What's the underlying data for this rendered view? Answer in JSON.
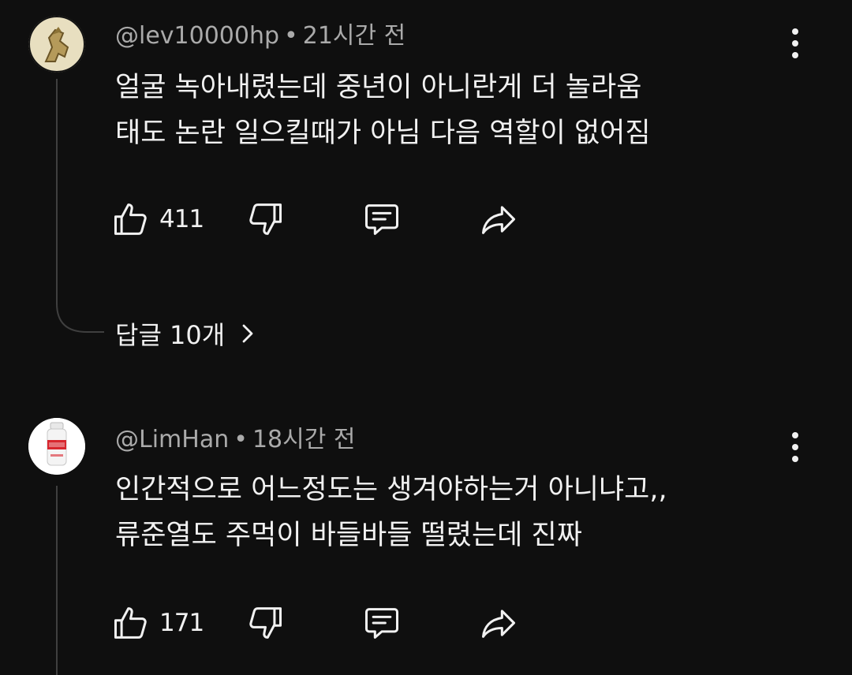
{
  "comments": [
    {
      "author": "@lev10000hp",
      "separator": "•",
      "time": "21시간 전",
      "lines": [
        "얼굴 녹아내렸는데 중년이 아니란게 더 놀라움",
        "태도 논란 일으킬때가 아님 다음 역할이 없어짐"
      ],
      "likes": "411",
      "icons": {
        "avatar": "avatar-image",
        "like": "thumbs-up-icon",
        "dislike": "thumbs-down-icon",
        "reply": "comment-icon",
        "share": "share-icon",
        "menu": "more-vert-icon"
      },
      "replies_label": "답글 10개",
      "replies_icon": "chevron-right-icon"
    },
    {
      "author": "@LimHan",
      "separator": "•",
      "time": "18시간 전",
      "lines": [
        "인간적으로 어느정도는 생겨야하는거 아니냐고,,",
        "류준열도 주먹이 바들바들 떨렸는데 진짜"
      ],
      "likes": "171",
      "icons": {
        "avatar": "avatar-image",
        "like": "thumbs-up-icon",
        "dislike": "thumbs-down-icon",
        "reply": "comment-icon",
        "share": "share-icon",
        "menu": "more-vert-icon"
      }
    }
  ],
  "colors": {
    "background": "#0f0f0f",
    "text": "#f1f1f1",
    "meta": "#aaaaaa",
    "thread_line": "#3f3f3f"
  }
}
